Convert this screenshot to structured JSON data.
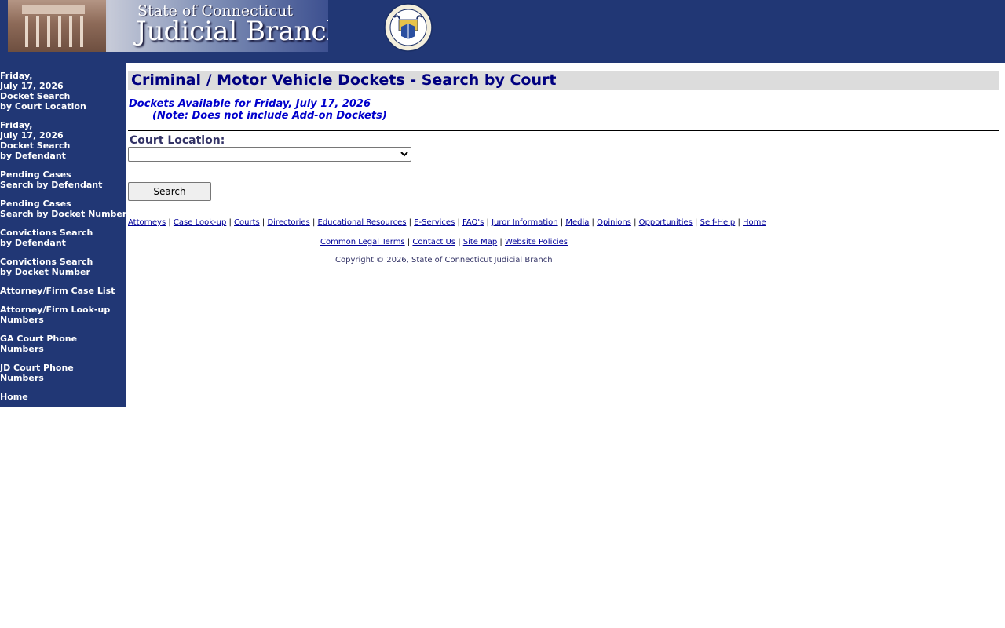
{
  "header": {
    "title_small": "State of Connecticut",
    "title_big": "Judicial Branch",
    "seal_lines": [
      "STATE OF CONNECTICUT",
      "JUDICIAL BRANCH"
    ]
  },
  "sidebar": {
    "items": [
      {
        "lines": [
          "Friday,",
          "July 17, 2026",
          "Docket Search",
          "by Court Location"
        ]
      },
      {
        "lines": [
          "Friday,",
          "July 17, 2026",
          "Docket Search",
          "by Defendant"
        ]
      },
      {
        "lines": [
          "Pending Cases",
          "Search by Defendant"
        ]
      },
      {
        "lines": [
          "Pending Cases",
          "Search by Docket Number"
        ]
      },
      {
        "lines": [
          "Convictions Search",
          "by Defendant"
        ]
      },
      {
        "lines": [
          "Convictions Search",
          "by Docket Number"
        ]
      },
      {
        "lines": [
          "Attorney/Firm Case List"
        ]
      },
      {
        "lines": [
          "Attorney/Firm Look-up",
          "Numbers"
        ]
      },
      {
        "lines": [
          "GA Court Phone",
          "Numbers"
        ]
      },
      {
        "lines": [
          "JD Court Phone",
          "Numbers"
        ]
      },
      {
        "lines": [
          "Home"
        ]
      }
    ]
  },
  "main": {
    "title": "Criminal / Motor Vehicle Dockets - Search by Court",
    "available": "Dockets Available for Friday, July 17, 2026",
    "note": "(Note: Does not include Add-on Dockets)",
    "court_label": "Court Location:",
    "court_value": "",
    "search_label": "Search"
  },
  "footer": {
    "links1": [
      "Attorneys",
      "Case Look-up",
      "Courts",
      "Directories",
      "Educational Resources",
      "E-Services",
      "FAQ's",
      "Juror Information",
      "Media",
      "Opinions",
      "Opportunities",
      "Self-Help",
      "Home"
    ],
    "links2": [
      "Common Legal Terms",
      "Contact Us",
      "Site Map",
      "Website Policies"
    ],
    "separator": " | ",
    "copyright": "Copyright © 2026, State of Connecticut Judicial Branch"
  },
  "colors": {
    "header_bg": "#213775",
    "title_color": "#000080",
    "available_color": "#0000cc"
  }
}
